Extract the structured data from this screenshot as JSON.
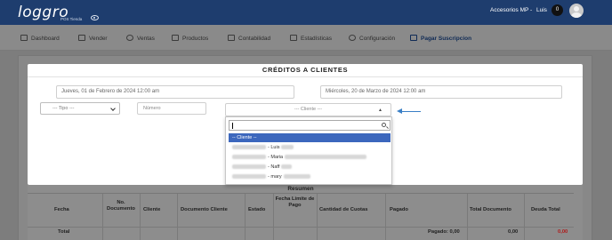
{
  "header": {
    "logo": "loggro",
    "logo_sub": "POS Tienda",
    "store": "Accesorios MP -",
    "user": "Luis",
    "notifications": "0"
  },
  "nav": {
    "items": [
      {
        "label": "Dashboard",
        "icon": "dashboard-icon"
      },
      {
        "label": "Vender",
        "icon": "cart-icon"
      },
      {
        "label": "Ventas",
        "icon": "dollar-circle-icon"
      },
      {
        "label": "Productos",
        "icon": "products-icon"
      },
      {
        "label": "Contabilidad",
        "icon": "accounting-icon"
      },
      {
        "label": "Estadísticas",
        "icon": "stats-icon"
      },
      {
        "label": "Configuración",
        "icon": "gear-icon"
      },
      {
        "label": "Pagar Suscripcion",
        "icon": "card-icon"
      }
    ]
  },
  "modal": {
    "title": "CRÉDITOS A CLIENTES",
    "date_from": "Jueves, 01 de Febrero de 2024 12:00 am",
    "date_to": "Miércoles, 20 de Marzo de 2024 12:00 am",
    "tipo_placeholder": "--- Tipo ---",
    "numero_placeholder": "Número",
    "cliente_placeholder": "--- Cliente ---",
    "cliente_arrow": "▲"
  },
  "dropdown": {
    "options": [
      {
        "label": "-- Cliente --",
        "selected": true
      },
      {
        "label": "- Luis"
      },
      {
        "label": "- Maria"
      },
      {
        "label": "- Naff"
      },
      {
        "label": "- mary"
      }
    ]
  },
  "table": {
    "title": "Resumen",
    "headers": [
      "Fecha",
      "No. Documento",
      "Cliente",
      "Documento Cliente",
      "Estado",
      "Fecha Limite de Pago",
      "Cantidad de Cuotas",
      "Pagado",
      "Total Documento",
      "Deuda Total"
    ],
    "total_label": "Total",
    "pagado_total": "Pagado: 0,00",
    "total_documento": "0,00",
    "deuda_total": "0,00"
  },
  "colors": {
    "header_bg": "#1e3d6e",
    "selected_option": "#3c67bd",
    "arrow": "#3a7fc6",
    "debt": "#b01919"
  }
}
